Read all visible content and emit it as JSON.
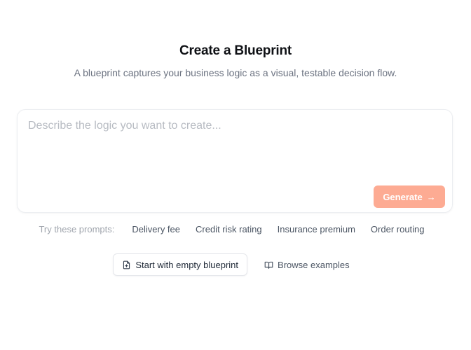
{
  "header": {
    "title": "Create a Blueprint",
    "subtitle": "A blueprint captures your business logic as a visual, testable decision flow."
  },
  "prompt": {
    "placeholder": "Describe the logic you want to create...",
    "value": "",
    "generate_label": "Generate",
    "generate_icon": "arrow-right-icon"
  },
  "suggestions": {
    "label": "Try these prompts:",
    "items": [
      {
        "label": "Delivery fee"
      },
      {
        "label": "Credit risk rating"
      },
      {
        "label": "Insurance premium"
      },
      {
        "label": "Order routing"
      }
    ]
  },
  "actions": {
    "empty_label": "Start with empty blueprint",
    "empty_icon": "file-plus-icon",
    "browse_label": "Browse examples",
    "browse_icon": "book-open-icon"
  },
  "colors": {
    "generate_button": "#fdab93",
    "title": "#0f1115",
    "muted_text": "#6b7280"
  }
}
